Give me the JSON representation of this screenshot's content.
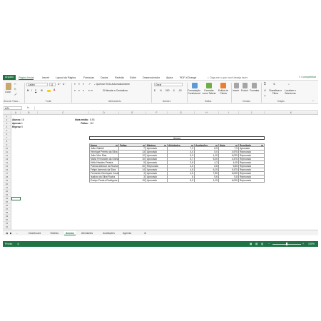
{
  "ribbon_tabs": [
    "Arquivo",
    "Página Inicial",
    "Inserir",
    "Layout da Página",
    "Fórmulas",
    "Dados",
    "Revisão",
    "Exibir",
    "Desenvolvedor",
    "Ajuda",
    "PDF-XChange"
  ],
  "tell_me": "Diga-me o que você deseja fazer",
  "share": "Compartilhar",
  "ribbon": {
    "paste": "Colar",
    "font_name": "Calibri",
    "font_size": "11",
    "wrap_text": "Quebrar Texto Automaticamente",
    "merge_center": "Mesclar e Centralizar",
    "number_format": "Geral",
    "conditional_format": "Formatação Condicional",
    "format_table": "Formatar como Tabela",
    "cell_styles": "Estilos de Célula",
    "insert": "Inserir",
    "delete": "Excluir",
    "format": "Formatar",
    "sort_filter": "Classificar e Filtrar",
    "find_select": "Localizar e Selecionar",
    "groups": {
      "clipboard": "Área de Trans...",
      "font": "Fonte",
      "alignment": "Alinhamento",
      "number": "Número",
      "styles": "Estilos",
      "cells": "Células",
      "editing": "Edição"
    }
  },
  "formula_bar": {
    "name_box": "A24",
    "fx": "fx",
    "value": ""
  },
  "columns": [
    "A",
    "B",
    "C",
    "D",
    "E",
    "F",
    "G",
    "H",
    "I",
    "J",
    "K"
  ],
  "rows": [
    "1",
    "2",
    "3",
    "4",
    "5",
    "6",
    "7",
    "8",
    "9",
    "10",
    "11",
    "12",
    "13",
    "14",
    "15",
    "16",
    "17",
    "18",
    "19",
    "20",
    "21",
    "22",
    "23",
    "24",
    "25",
    "26",
    "27",
    "28",
    "29",
    "30",
    "31",
    "32",
    "33"
  ],
  "summary": {
    "alunos_label": "Alunos:",
    "alunos_value": "15",
    "aprovados_label": "Aprovados:",
    "aprovados_value": "1",
    "reprovados_label": "Reprovados:",
    "reprovados_value": "9",
    "nota_media_label": "Nota média:",
    "nota_media_value": "5,93",
    "faltas_label": "Faltas:",
    "faltas_value": "112"
  },
  "table": {
    "title": "Alunos",
    "headers": [
      "Nome",
      "Faltas",
      "Máximo",
      "Atividades",
      "Avaliações",
      "Nota",
      "Resultado"
    ],
    "rows": [
      [
        "João Gabriel",
        "7",
        "Aprovado",
        "7,3",
        "8,5",
        "7,9",
        "Aprovado"
      ],
      [
        "Henrique Pereira da Silva",
        "13",
        "Aprovado",
        "4,0",
        "5,0",
        "4,975",
        "Reprovado"
      ],
      [
        "João Vitor Dias",
        "12",
        "Aprovado",
        "5,9",
        "4,15",
        "6,025",
        "Reprovado"
      ],
      [
        "Maria Fernandes da Glória Silva",
        "10",
        "Aprovado",
        "3,7",
        "5,25",
        "4,475",
        "Reprovado"
      ],
      [
        "Hélio Nandes Pereira",
        "9",
        "Aprovado",
        "3,8",
        "4,3",
        "4,05",
        "Reprovado"
      ],
      [
        "Patrícia Alencar da Rocha",
        "20",
        "Reprovado",
        "4,5",
        "6,8",
        "5,65",
        "Reprovado"
      ],
      [
        "Felipe Azevedo da Silva",
        "14",
        "Aprovado",
        "4,8",
        "6,15",
        "5,475",
        "Reprovado"
      ],
      [
        "Fernando Henriquez Costa",
        "4",
        "Aprovado",
        "4,5",
        "7,55",
        "6,025",
        "Reprovado"
      ],
      [
        "Isadora da Silva Rocha",
        "3",
        "Aprovado",
        "6",
        "5,6",
        "5,8",
        "Reprovado"
      ],
      [
        "Evelyn Pereira Rodriguez de Oliveira",
        "19",
        "Aprovado",
        "5,9",
        "4,15",
        "6,025",
        "Reprovado"
      ]
    ]
  },
  "sheet_tabs": [
    "Dashboard",
    "Tabelas",
    "Alunos",
    "Atividades",
    "Avaliações",
    "Agenda"
  ],
  "active_sheet": "Alunos",
  "status": {
    "ready": "Pronto",
    "zoom": "100%"
  },
  "colors": {
    "excel_green": "#217346"
  }
}
